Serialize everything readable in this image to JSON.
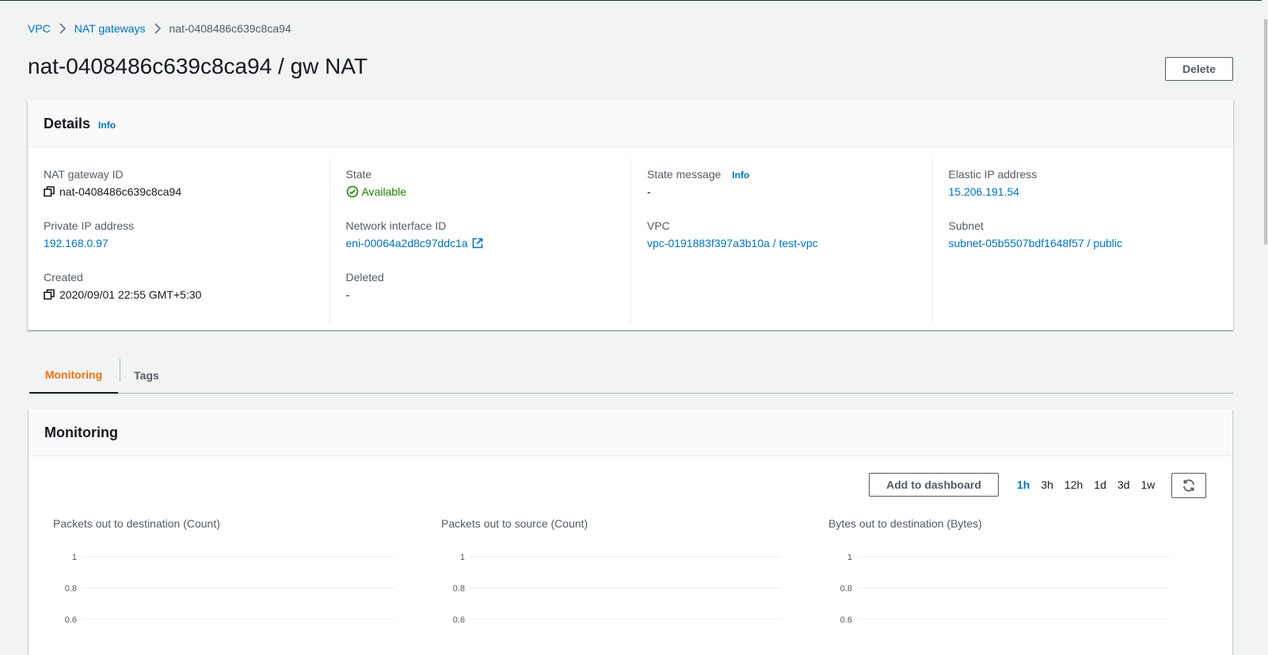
{
  "breadcrumb": {
    "items": [
      "VPC",
      "NAT gateways"
    ],
    "current": "nat-0408486c639c8ca94"
  },
  "page": {
    "title": "nat-0408486c639c8ca94 / gw NAT",
    "delete_label": "Delete"
  },
  "details": {
    "heading": "Details",
    "info": "Info",
    "columns": [
      [
        {
          "label": "NAT gateway ID",
          "value": "nat-0408486c639c8ca94"
        },
        {
          "label": "Private IP address",
          "value": "192.168.0.97"
        },
        {
          "label": "Created",
          "value": "2020/09/01 22:55 GMT+5:30"
        }
      ],
      [
        {
          "label": "State",
          "value": "Available"
        },
        {
          "label": "Network interface ID",
          "value": "eni-00064a2d8c97ddc1a"
        },
        {
          "label": "Deleted",
          "value": "-"
        }
      ],
      [
        {
          "label": "State message",
          "info": "Info",
          "value": "-"
        },
        {
          "label": "VPC",
          "value": "vpc-0191883f397a3b10a / test-vpc"
        }
      ],
      [
        {
          "label": "Elastic IP address",
          "value": "15.206.191.54"
        },
        {
          "label": "Subnet",
          "value": "subnet-05b5507bdf1648f57 / public"
        }
      ]
    ]
  },
  "tabs": [
    "Monitoring",
    "Tags"
  ],
  "monitoring": {
    "heading": "Monitoring",
    "add_to_dashboard": "Add to dashboard",
    "ranges": [
      "1h",
      "3h",
      "12h",
      "1d",
      "3d",
      "1w"
    ],
    "active_range": "1h"
  },
  "chart_data": [
    {
      "type": "line",
      "title": "Packets out to destination (Count)",
      "y_ticks": [
        "1",
        "0.8",
        "0.6"
      ],
      "ylim": [
        0,
        1
      ],
      "series": []
    },
    {
      "type": "line",
      "title": "Packets out to source (Count)",
      "y_ticks": [
        "1",
        "0.8",
        "0.6"
      ],
      "ylim": [
        0,
        1
      ],
      "series": []
    },
    {
      "type": "line",
      "title": "Bytes out to destination (Bytes)",
      "y_ticks": [
        "1",
        "0.8",
        "0.6"
      ],
      "ylim": [
        0,
        1
      ],
      "series": []
    }
  ],
  "colors": {
    "link": "#0073bb",
    "success": "#1d8102",
    "tab_active": "#ec7211"
  }
}
